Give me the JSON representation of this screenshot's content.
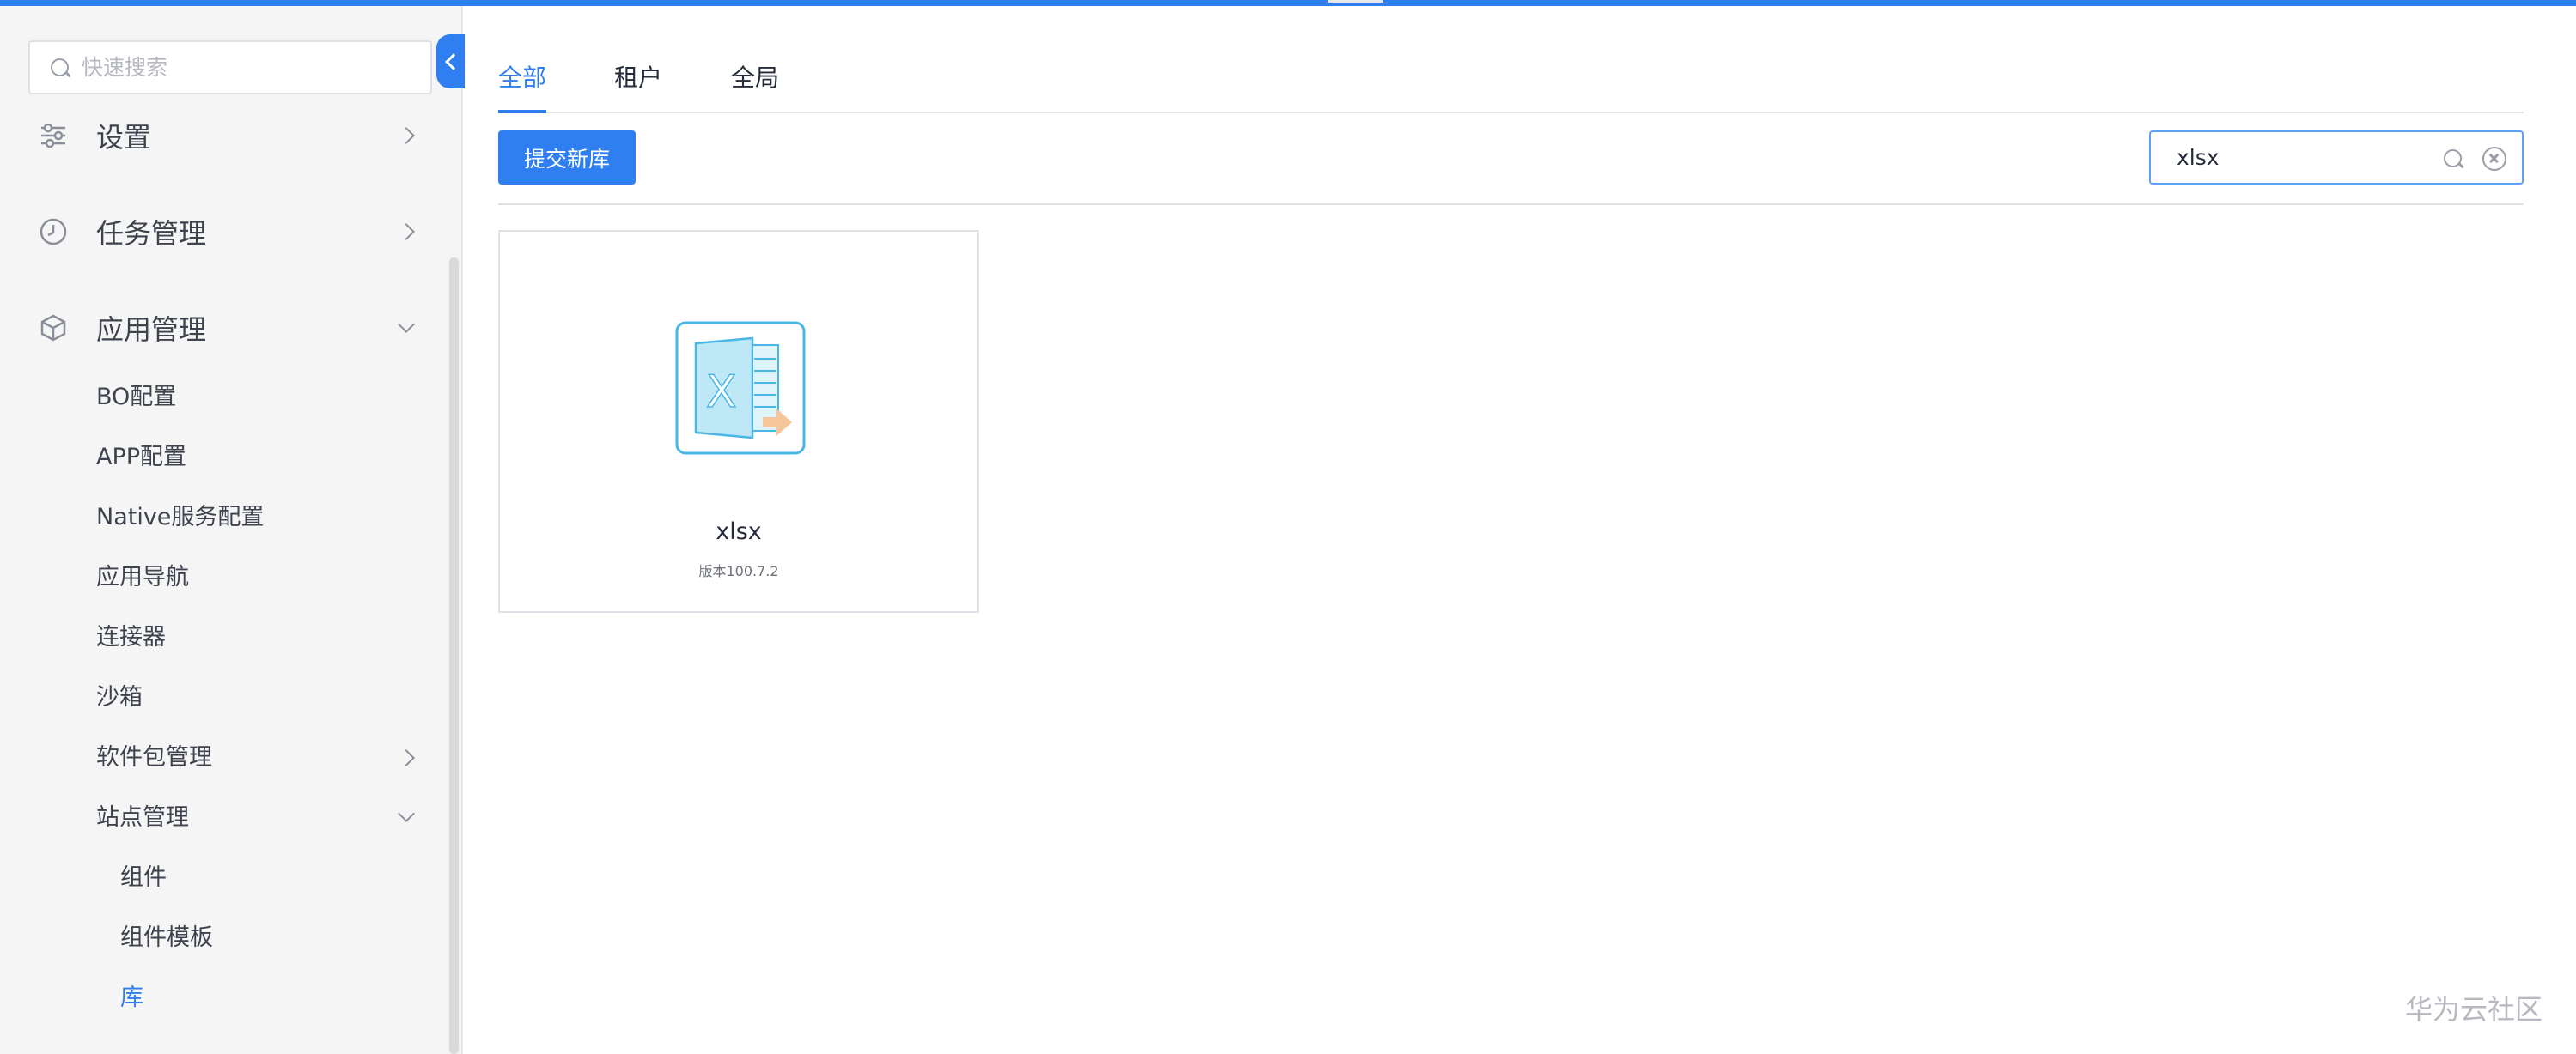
{
  "sidebar": {
    "search_placeholder": "快速搜索",
    "menu": [
      {
        "label": "设置",
        "icon": "sliders-icon"
      },
      {
        "label": "任务管理",
        "icon": "clock-icon"
      },
      {
        "label": "应用管理",
        "icon": "cube-icon"
      }
    ],
    "app_management_items": [
      "BO配置",
      "APP配置",
      "Native服务配置",
      "应用导航",
      "连接器",
      "沙箱",
      "软件包管理",
      "站点管理"
    ],
    "site_management_items": [
      "组件",
      "组件模板",
      "库"
    ],
    "active_item": "库"
  },
  "main": {
    "tabs": [
      {
        "label": "全部",
        "active": true
      },
      {
        "label": "租户",
        "active": false
      },
      {
        "label": "全局",
        "active": false
      }
    ],
    "submit_button": "提交新库",
    "search_value": "xlsx",
    "cards": [
      {
        "name": "xlsx",
        "version_prefix": "版本",
        "version": "100.7.2",
        "icon": "excel-file-icon"
      }
    ]
  },
  "watermark": "华为云社区",
  "colors": {
    "accent": "#2f7ff0",
    "sidebar_bg": "#f5f5f6",
    "text": "#252b3a"
  }
}
